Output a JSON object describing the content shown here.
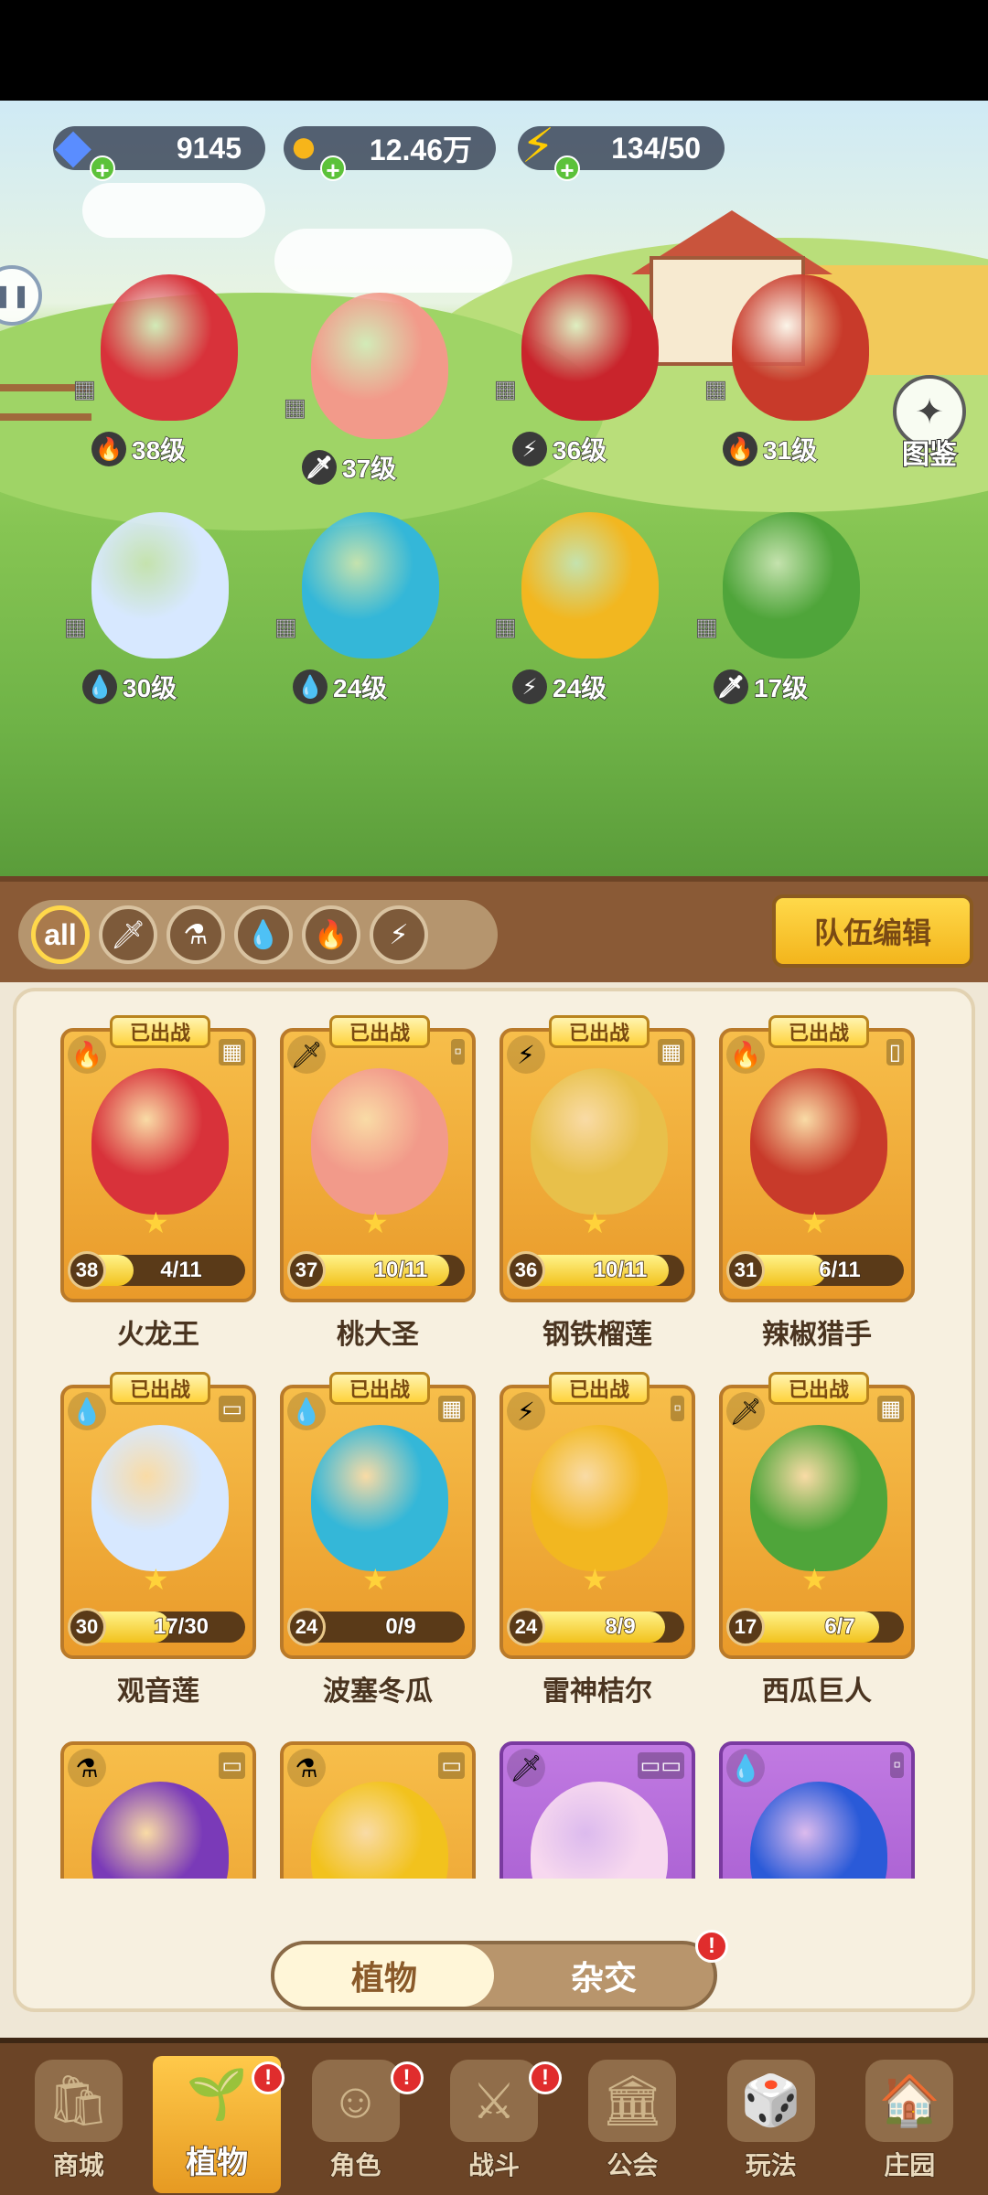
{
  "currencies": {
    "gems": "9145",
    "coins": "12.46万",
    "energy": "134/50"
  },
  "codex_label": "图鉴",
  "team": [
    {
      "level": "38级",
      "element": "fire",
      "color": "#d8323a"
    },
    {
      "level": "37级",
      "element": "sword",
      "color": "#f29a8a"
    },
    {
      "level": "36级",
      "element": "lightning",
      "color": "#c9242c"
    },
    {
      "level": "31级",
      "element": "fire",
      "color": "#c83a2a"
    },
    {
      "level": "30级",
      "element": "water",
      "color": "#d7e8ff"
    },
    {
      "level": "24级",
      "element": "water",
      "color": "#34b7d8"
    },
    {
      "level": "24级",
      "element": "lightning",
      "color": "#f2b720"
    },
    {
      "level": "17级",
      "element": "sword",
      "color": "#4fa53a"
    }
  ],
  "filters": {
    "all_label": "all",
    "items": [
      "sword",
      "potion",
      "water",
      "fire",
      "lightning"
    ]
  },
  "team_edit_label": "队伍编辑",
  "deployed_label": "已出战",
  "cards": [
    {
      "name": "火龙王",
      "level": "38",
      "fragments": "4/11",
      "progress": 0.36,
      "element": "fire",
      "color": "#d8323a",
      "slot": "▦"
    },
    {
      "name": "桃大圣",
      "level": "37",
      "fragments": "10/11",
      "progress": 0.91,
      "element": "sword",
      "color": "#f29a8a",
      "slot": "▫"
    },
    {
      "name": "钢铁榴莲",
      "level": "36",
      "fragments": "10/11",
      "progress": 0.91,
      "element": "lightning",
      "color": "#e8c04a",
      "slot": "▦"
    },
    {
      "name": "辣椒猎手",
      "level": "31",
      "fragments": "6/11",
      "progress": 0.55,
      "element": "fire",
      "color": "#c83a2a",
      "slot": "▯"
    },
    {
      "name": "观音莲",
      "level": "30",
      "fragments": "17/30",
      "progress": 0.57,
      "element": "water",
      "color": "#d7e8ff",
      "slot": "▭"
    },
    {
      "name": "波塞冬瓜",
      "level": "24",
      "fragments": "0/9",
      "progress": 0.0,
      "element": "water",
      "color": "#34b7d8",
      "slot": "▦"
    },
    {
      "name": "雷神桔尔",
      "level": "24",
      "fragments": "8/9",
      "progress": 0.89,
      "element": "lightning",
      "color": "#f2b720",
      "slot": "▫"
    },
    {
      "name": "西瓜巨人",
      "level": "17",
      "fragments": "6/7",
      "progress": 0.86,
      "element": "sword",
      "color": "#4fa53a",
      "slot": "▦"
    }
  ],
  "partial_cards": [
    {
      "element": "potion",
      "purple": false,
      "color": "#7a3ab8",
      "slot": "▭"
    },
    {
      "element": "potion",
      "purple": false,
      "color": "#f2c21d",
      "slot": "▭"
    },
    {
      "element": "sword",
      "purple": true,
      "color": "#f7d8ef",
      "slot": "▭▭"
    },
    {
      "element": "water",
      "purple": true,
      "color": "#2a5ad8",
      "slot": "▫"
    }
  ],
  "subtabs": {
    "plants": "植物",
    "hybrid": "杂交",
    "hybrid_badge": "!"
  },
  "nav": [
    {
      "label": "商城",
      "badge": ""
    },
    {
      "label": "植物",
      "badge": "!"
    },
    {
      "label": "角色",
      "badge": "!"
    },
    {
      "label": "战斗",
      "badge": "!"
    },
    {
      "label": "公会",
      "badge": ""
    },
    {
      "label": "玩法",
      "badge": ""
    },
    {
      "label": "庄园",
      "badge": ""
    }
  ],
  "element_icons": {
    "fire": "🔥",
    "sword": "🗡",
    "lightning": "⚡",
    "water": "💧",
    "potion": "⚗"
  }
}
